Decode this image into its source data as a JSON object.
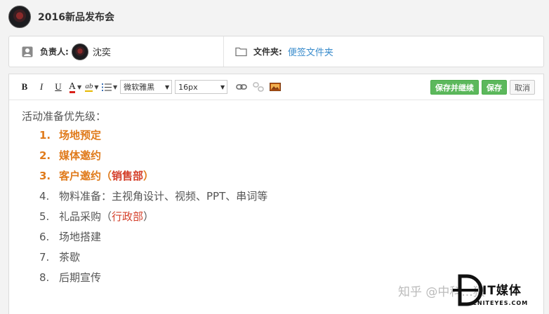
{
  "header": {
    "title": "2016新品发布会"
  },
  "info": {
    "owner_label": "负责人:",
    "owner_name": "沈奕",
    "folder_label": "文件夹:",
    "folder_name": "便签文件夹"
  },
  "toolbar": {
    "bold": "B",
    "italic": "I",
    "underline": "U",
    "font_color": "A",
    "highlight": "ab",
    "font_family": "微软雅黑",
    "font_size": "16px",
    "save_continue": "保存并继续",
    "save": "保存",
    "cancel": "取消"
  },
  "content": {
    "intro": "活动准备优先级：",
    "items": [
      {
        "num": "1.",
        "text": "场地预定"
      },
      {
        "num": "2.",
        "text": "媒体邀约"
      },
      {
        "num": "3.",
        "text": "客户邀约（",
        "dept": "销售部",
        "close": "）"
      },
      {
        "num": "4.",
        "text": "物料准备：主视角设计、视频、PPT、串词等"
      },
      {
        "num": "5.",
        "text": "礼品采购（",
        "dept": "行政部",
        "close": "）"
      },
      {
        "num": "6.",
        "text": "场地搭建"
      },
      {
        "num": "7.",
        "text": "茶歇"
      },
      {
        "num": "8.",
        "text": "后期宣传"
      }
    ]
  },
  "watermark": {
    "text": "知乎 @中科...狼",
    "brand": "IT媒体",
    "sub": "CNITEYES.COM"
  }
}
